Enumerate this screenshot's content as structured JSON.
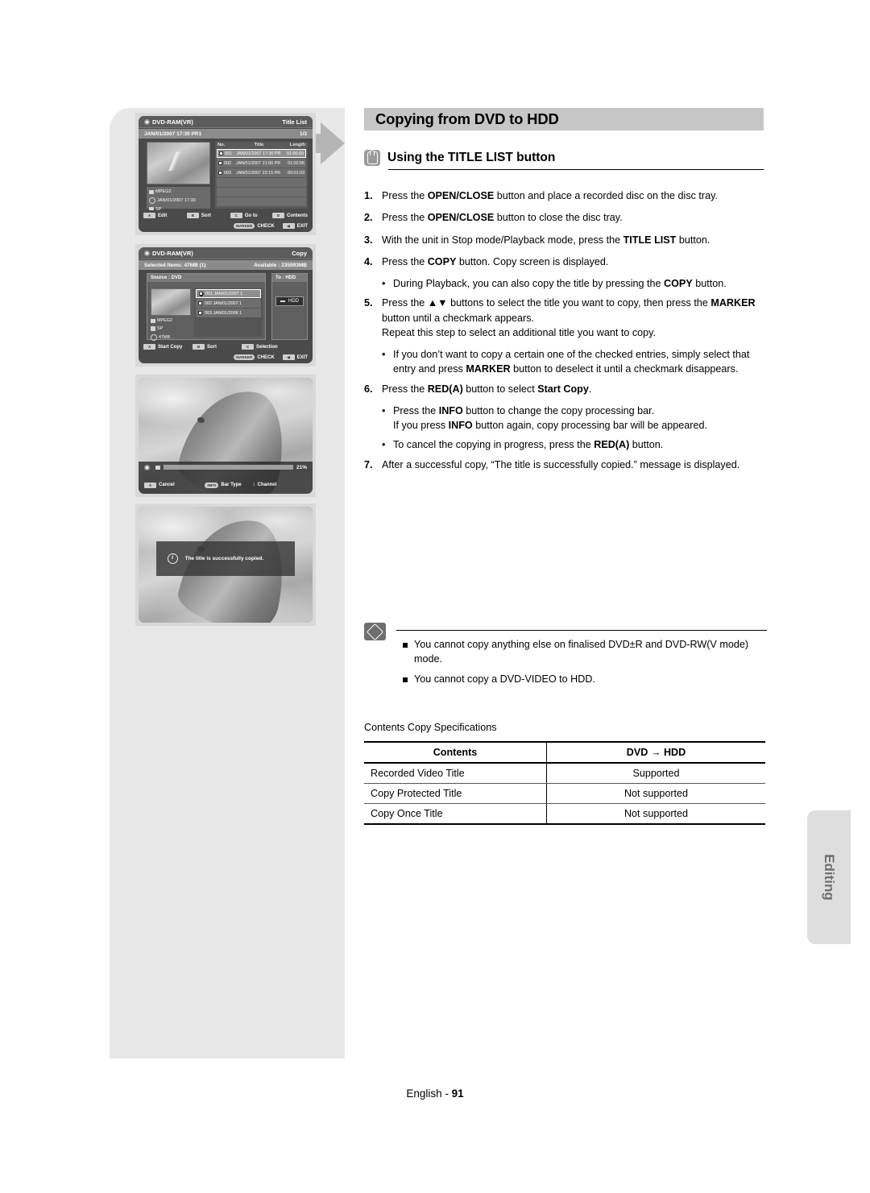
{
  "page": {
    "title": "Copying from DVD to HDD",
    "section_icon": "hand-pointer-icon",
    "section_title": "Using the TITLE LIST button",
    "footer_label": "English -",
    "footer_page": "91",
    "side_tab": "Editing"
  },
  "steps": [
    {
      "num": "1.",
      "html": "Press the <b>OPEN/CLOSE</b> button and place a recorded disc on the disc tray."
    },
    {
      "num": "2.",
      "html": "Press the <b>OPEN/CLOSE</b> button to close the disc tray."
    },
    {
      "num": "3.",
      "html": "With the unit in Stop mode/Playback mode, press the <b>TITLE LIST</b> button."
    },
    {
      "num": "4.",
      "html": "Press the <b>COPY</b> button. Copy screen is displayed."
    },
    {
      "num": "bullet",
      "html": "During Playback, you can also copy the title by pressing the <b>COPY</b> button."
    },
    {
      "num": "5.",
      "html": "Press the ▲▼ buttons to select the title you want to copy, then press the <b>MARKER</b> button until a checkmark appears.<br>Repeat this step to select an additional title you want to copy."
    },
    {
      "num": "bullet",
      "html": "If you don’t want to copy a certain one of the checked entries, simply select that entry and press <b>MARKER</b> button to deselect it until a checkmark disappears."
    },
    {
      "num": "6.",
      "html": "Press the <b>RED(A)</b> button to select <b>Start Copy</b>."
    },
    {
      "num": "bullet",
      "html": "Press the <b>INFO</b> button to change the copy processing bar.<br>If you press <b>INFO</b> button again, copy processing bar will be appeared."
    },
    {
      "num": "bullet",
      "html": "To cancel the copying in progress, press the <b>RED(A)</b> button."
    },
    {
      "num": "7.",
      "html": "After a successful copy, “The title is successfully copied.” message is displayed."
    }
  ],
  "note": {
    "icon": "pencil-note-icon",
    "items": [
      "You cannot copy anything else on finalised DVD±R and DVD-RW(V mode) mode.",
      "You cannot copy a DVD-VIDEO to HDD."
    ]
  },
  "spec_table": {
    "caption": "Contents Copy Specifications",
    "headers": [
      "Contents",
      "DVD → HDD"
    ],
    "rows": [
      [
        "Recorded Video Title",
        "Supported"
      ],
      [
        "Copy Protected Title",
        "Not supported"
      ],
      [
        "Copy Once Title",
        "Not supported"
      ]
    ]
  },
  "screens": {
    "title_list": {
      "disc_label": "DVD-RAM(VR)",
      "mode_label": "Title List",
      "date_label": "JAN/01/2007 17:30 PR1",
      "count_label": "1/3",
      "info": [
        "MPEG2",
        "JAN/01/2007 17:30",
        "SP"
      ],
      "columns": [
        "No.",
        "Title",
        "Length"
      ],
      "rows": [
        {
          "no": "001",
          "title": "JAN/01/2007 17:30 PR",
          "length": "01:00:00",
          "checked": false,
          "selected": true
        },
        {
          "no": "002",
          "title": "JAN/01/2007 21:00 PR",
          "length": "01:02:06",
          "checked": false,
          "selected": false
        },
        {
          "no": "003",
          "title": "JAN/01/2007 23:15 PR",
          "length": "00:01:03",
          "checked": false,
          "selected": false
        }
      ],
      "footer_keys": [
        {
          "key": "A",
          "label": "Edit"
        },
        {
          "key": "B",
          "label": "Sort"
        },
        {
          "key": "C",
          "label": "Go to"
        },
        {
          "key": "D",
          "label": "Contents"
        }
      ],
      "footer_keys2": [
        {
          "key": "MARKER",
          "label": "CHECK"
        },
        {
          "key": "◀",
          "label": "EXIT"
        }
      ]
    },
    "copy_screen": {
      "disc_label": "DVD-RAM(VR)",
      "mode_label": "Copy",
      "selected_label": "Selected Items: 47MB  (1)",
      "available_label": "Available : 235993MB",
      "source_label": "Source : DVD",
      "dest_label": "To : HDD",
      "dest_item": "HDD",
      "info": [
        "MPEG2",
        "SP",
        "47MB"
      ],
      "rows": [
        {
          "text": "001 JAN/01/2007 1",
          "checked": true,
          "selected": true
        },
        {
          "text": "002 JAN/01/2007 1",
          "checked": false,
          "selected": false
        },
        {
          "text": "003 JAN/01/2006 1",
          "checked": false,
          "selected": false
        }
      ],
      "footer_keys": [
        {
          "key": "A",
          "label": "Start Copy"
        },
        {
          "key": "B",
          "label": "Sort"
        },
        {
          "key": "C",
          "label": "Selection"
        }
      ],
      "footer_keys2": [
        {
          "key": "MARKER",
          "label": "CHECK"
        },
        {
          "key": "◀",
          "label": "EXIT"
        }
      ]
    },
    "progress_screen": {
      "percent_label": "21%",
      "percent_value": 21,
      "footer_keys": [
        {
          "key": "A",
          "label": "Cancel"
        },
        {
          "key": "INFO",
          "label": "Bar Type"
        },
        {
          "key": "↕",
          "label": "Channel"
        }
      ]
    },
    "message_screen": {
      "icon": "info-icon",
      "message": "The title is successfully copied."
    }
  },
  "colors": {
    "banner_bg": "#c6c6c6",
    "panel_bg": "#e8e8e8",
    "tab_bg": "#dedede",
    "osd_bg": "#4a4a4a"
  }
}
